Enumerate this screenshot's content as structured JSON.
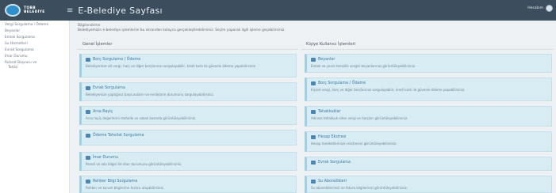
{
  "header": {
    "logo_line1": "TOBB",
    "logo_line2": "BELEDİYE",
    "menu_icon": "hamburger-icon",
    "title": "E-Belediye Sayfası",
    "user_label": "Hesabım"
  },
  "sidebar": {
    "items": [
      {
        "label": "Vergi Sorgulama / Ödeme"
      },
      {
        "label": "Beyanlar"
      },
      {
        "label": "Emlak Sorgulama"
      },
      {
        "label": "Su Hizmetleri"
      },
      {
        "label": "Evrak Sorgulama"
      },
      {
        "label": "İmar Durumu"
      },
      {
        "label": "Ruhsat Başvuru ve"
      },
      {
        "label": "Takibi"
      }
    ]
  },
  "main": {
    "info_title": "Bilgilendirme",
    "info_text": "Belediyemizin e-belediye işlemlerini bu ekrandan kolayca gerçekleştirebilirsiniz. Seçim yaparak ilgili işleme geçebilirsiniz.",
    "left_title": "Genel İşlemler",
    "right_title": "Kişiye Kullanıcı İşlemleri",
    "left_cards": [
      {
        "title": "Borç Sorgulama / Ödeme",
        "desc": "Belediyemize ait vergi, harç ve diğer borçlarınızı sorgulayabilir, kredi kartı ile güvenle ödeme yapabilirsiniz."
      },
      {
        "title": "Evrak Sorgulama",
        "desc": "Belediyemize yaptığınız başvuruların ve evrakların durumunu sorgulayabilirsiniz."
      },
      {
        "title": "Arsa Rayiç",
        "desc": "Arsa rayiç değerlerini mahalle ve sokak bazında görüntüleyebilirsiniz."
      },
      {
        "title": "Ödeme Tahsilat Sorgulama",
        "desc": ""
      },
      {
        "title": "İmar Durumu",
        "desc": "Parsel ve ada bilgisi ile imar durumunu görüntüleyebilirsiniz."
      },
      {
        "title": "Rehber Bilgi Sorgulama",
        "desc": "Rehber ve kurum bilgilerine hızlıca ulaşabilirsiniz."
      }
    ],
    "right_cards": [
      {
        "title": "Beyanlar",
        "desc": "Emlak ve çevre temizlik vergisi beyanlarınızı görüntüleyebilirsiniz."
      },
      {
        "title": "Borç Sorgulama / Ödeme",
        "desc": "Kişisel vergi, harç ve diğer borçlarınızı sorgulayabilir, kredi kartı ile güvenle ödeme yapabilirsiniz."
      },
      {
        "title": "Tahakkuklar",
        "desc": "Adınıza tahakkuk eden vergi ve harçları görüntüleyebilirsiniz."
      },
      {
        "title": "Hesap Ekstresi",
        "desc": "Hesap hareketlerinizin ekstresini görüntüleyebilirsiniz."
      },
      {
        "title": "Evrak Sorgulama",
        "desc": ""
      },
      {
        "title": "Su Abonelikleri",
        "desc": "Su aboneliklerinizi ve fatura bilgilerinizi görüntüleyebilirsiniz."
      }
    ]
  },
  "colors": {
    "topbar": "#3c4e5e",
    "card_bg": "#d7ecf3",
    "card_title": "#3d78a8"
  }
}
